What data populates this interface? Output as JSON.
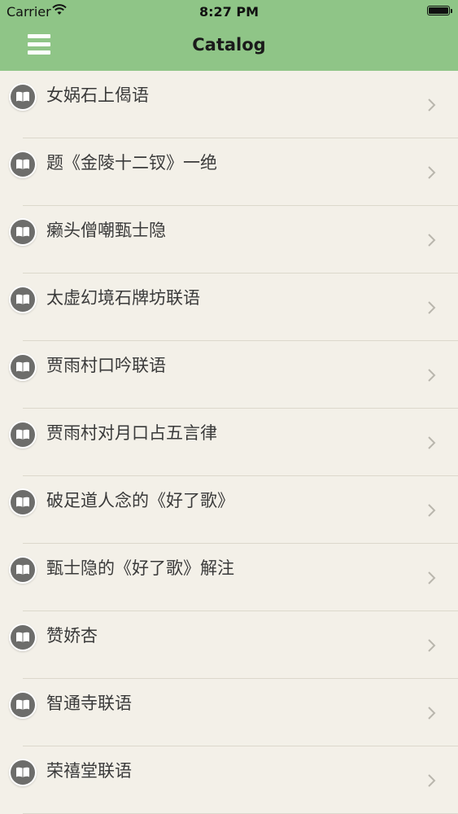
{
  "status_bar": {
    "carrier": "Carrier",
    "time": "8:27 PM"
  },
  "header": {
    "title": "Catalog",
    "menu_icon": "hamburger-menu-icon"
  },
  "colors": {
    "header_bg": "#8fc587",
    "page_bg": "#f3f0e8",
    "text": "#3a3a3a"
  },
  "items": [
    {
      "label": "女娲石上偈语"
    },
    {
      "label": "题《金陵十二钗》一绝"
    },
    {
      "label": "癞头僧嘲甄士隐"
    },
    {
      "label": "太虚幻境石牌坊联语"
    },
    {
      "label": "贾雨村口吟联语"
    },
    {
      "label": "贾雨村对月口占五言律"
    },
    {
      "label": "破足道人念的《好了歌》"
    },
    {
      "label": "甄士隐的《好了歌》解注"
    },
    {
      "label": "赞娇杏"
    },
    {
      "label": "智通寺联语"
    },
    {
      "label": "荣禧堂联语"
    }
  ]
}
